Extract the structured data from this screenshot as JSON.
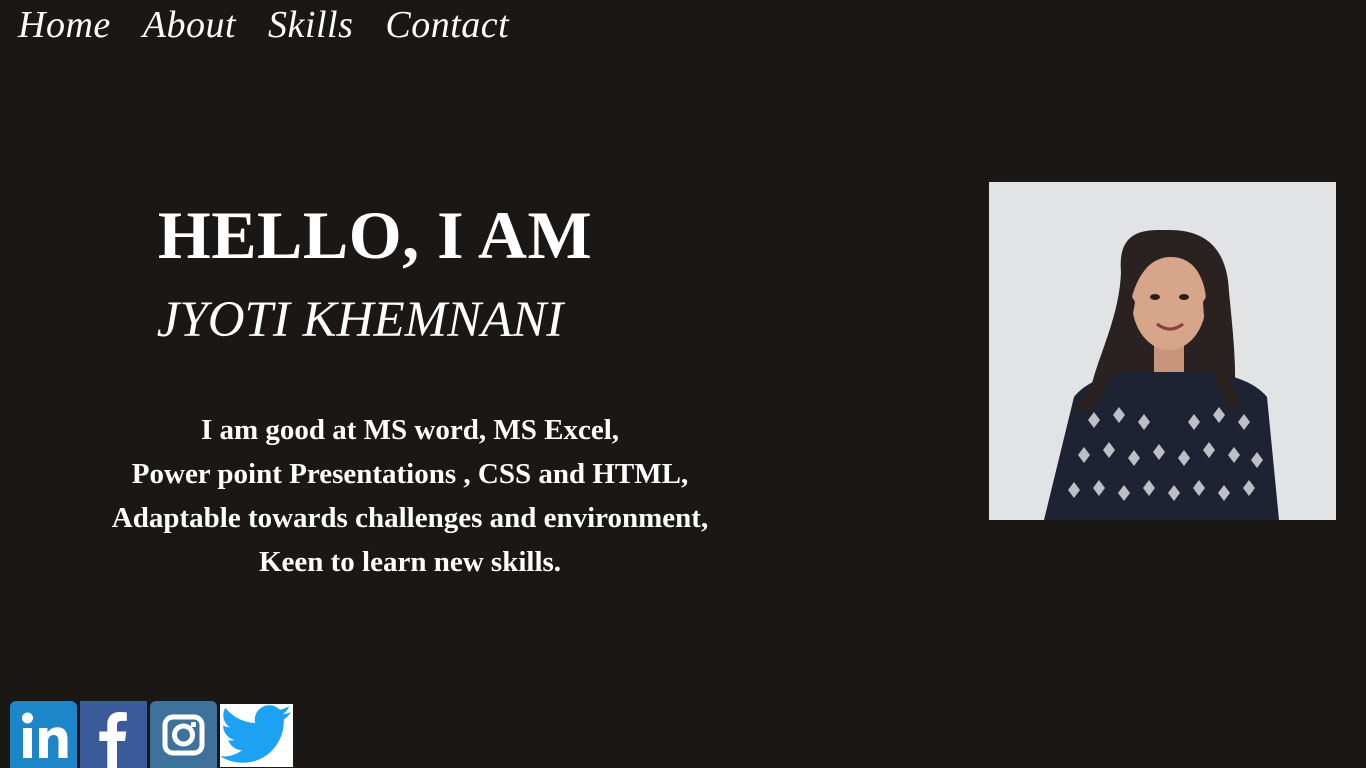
{
  "nav": {
    "items": [
      {
        "label": "Home"
      },
      {
        "label": "About"
      },
      {
        "label": "Skills"
      },
      {
        "label": "Contact"
      }
    ]
  },
  "hero": {
    "greeting": "HELLO, I AM",
    "name": "JYOTI KHEMNANI",
    "skills_lines": [
      "I am good at MS word, MS Excel,",
      "Power point Presentations , CSS and HTML,",
      "Adaptable towards challenges and environment,",
      "Keen to learn new skills."
    ]
  },
  "social": {
    "icons": [
      "linkedin-icon",
      "facebook-icon",
      "instagram-icon",
      "twitter-icon"
    ]
  },
  "colors": {
    "background": "#1b1715",
    "text": "#ffffff",
    "linkedin": "#1c86c8",
    "facebook": "#3b5a9a",
    "instagram": "#3f729b",
    "twitter": "#1da1f2"
  }
}
